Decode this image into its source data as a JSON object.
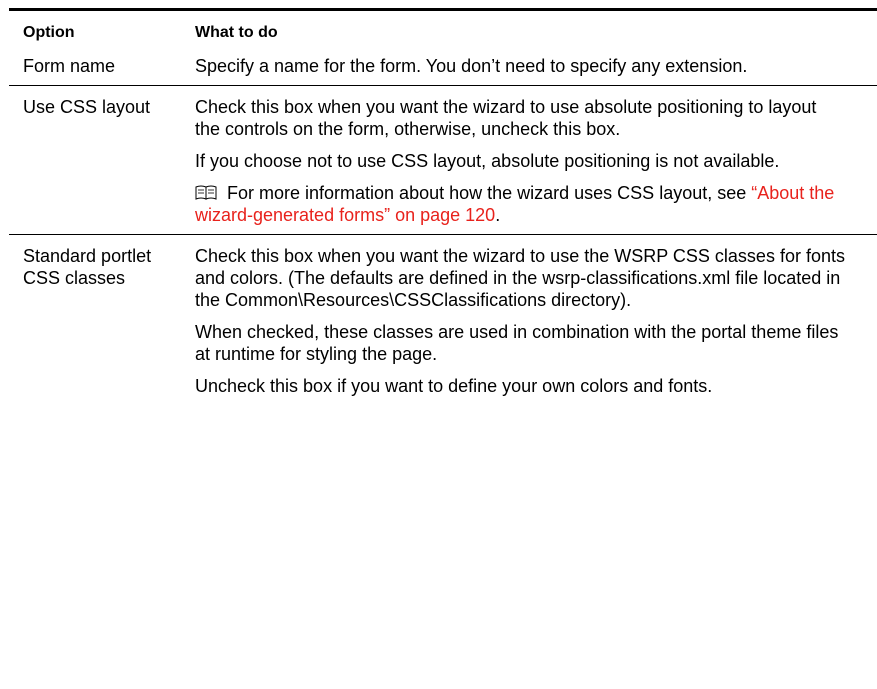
{
  "table": {
    "headers": {
      "option": "Option",
      "what_to_do": "What to do"
    },
    "rows": [
      {
        "option": "Form name",
        "paragraphs": [
          "Specify a name for the form. You don’t need to specify any extension."
        ]
      },
      {
        "option": "Use CSS layout",
        "paragraphs": [
          "Check this box when you want the wizard to use absolute positioning to layout the controls on the form, otherwise, uncheck this box.",
          "If you choose not to use CSS layout, absolute positioning is not available."
        ],
        "note": {
          "icon": "book-icon",
          "text_before": "For more information about how the wizard uses CSS layout, see ",
          "link_text": "“About the wizard-generated forms” on page 120",
          "text_after": "."
        }
      },
      {
        "option": "Standard portlet CSS classes",
        "paragraphs": [
          "Check this box when you want the wizard to use the WSRP CSS classes for fonts and colors. (The defaults are defined in the wsrp-classifications.xml file located in the Common\\Resources\\CSSClassifications directory).",
          "When checked, these classes are used in combination with the portal theme files at runtime for styling the page.",
          "Uncheck this box if you want to define your own colors and fonts."
        ]
      }
    ]
  },
  "colors": {
    "link": "#e8221c",
    "text": "#000000",
    "rule": "#000000"
  }
}
